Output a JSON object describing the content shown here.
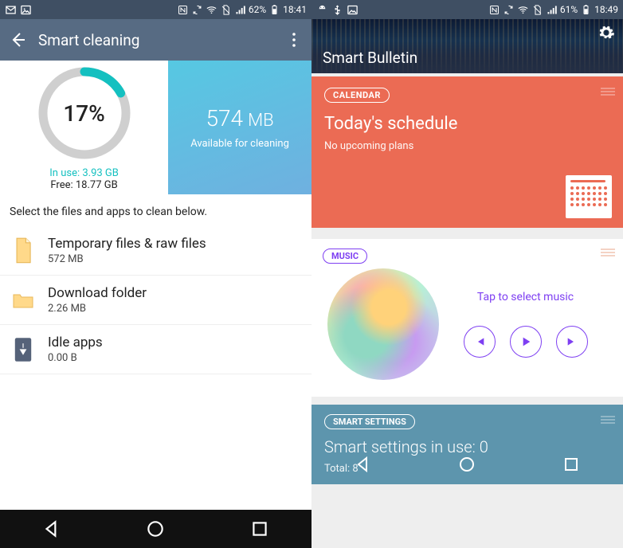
{
  "left": {
    "status": {
      "battery": "62%",
      "time": "18:41"
    },
    "appbar": {
      "title": "Smart cleaning"
    },
    "donut": {
      "percent_label": "17%",
      "percent_value": 17
    },
    "stats": {
      "inuse_label": "In use: 3.93  GB",
      "free_label": "Free: 18.77  GB"
    },
    "available": {
      "value": "574",
      "unit": "MB",
      "sub": "Available for cleaning"
    },
    "instruction": "Select the files and apps to clean below.",
    "rows": [
      {
        "title": "Temporary files & raw files",
        "sub": "572  MB"
      },
      {
        "title": "Download folder",
        "sub": "2.26  MB"
      },
      {
        "title": "Idle apps",
        "sub": "0.00  B"
      }
    ]
  },
  "right": {
    "status": {
      "battery": "61%",
      "time": "18:49"
    },
    "header": {
      "title": "Smart Bulletin"
    },
    "calendar": {
      "chip": "CALENDAR",
      "title": "Today's schedule",
      "sub": "No upcoming plans"
    },
    "music": {
      "chip": "MUSIC",
      "tap": "Tap to select music"
    },
    "smart_settings": {
      "chip": "SMART SETTINGS",
      "title_prefix": "Smart settings in use:  ",
      "count": "0",
      "total_prefix": "Total:  ",
      "total": "8"
    }
  }
}
